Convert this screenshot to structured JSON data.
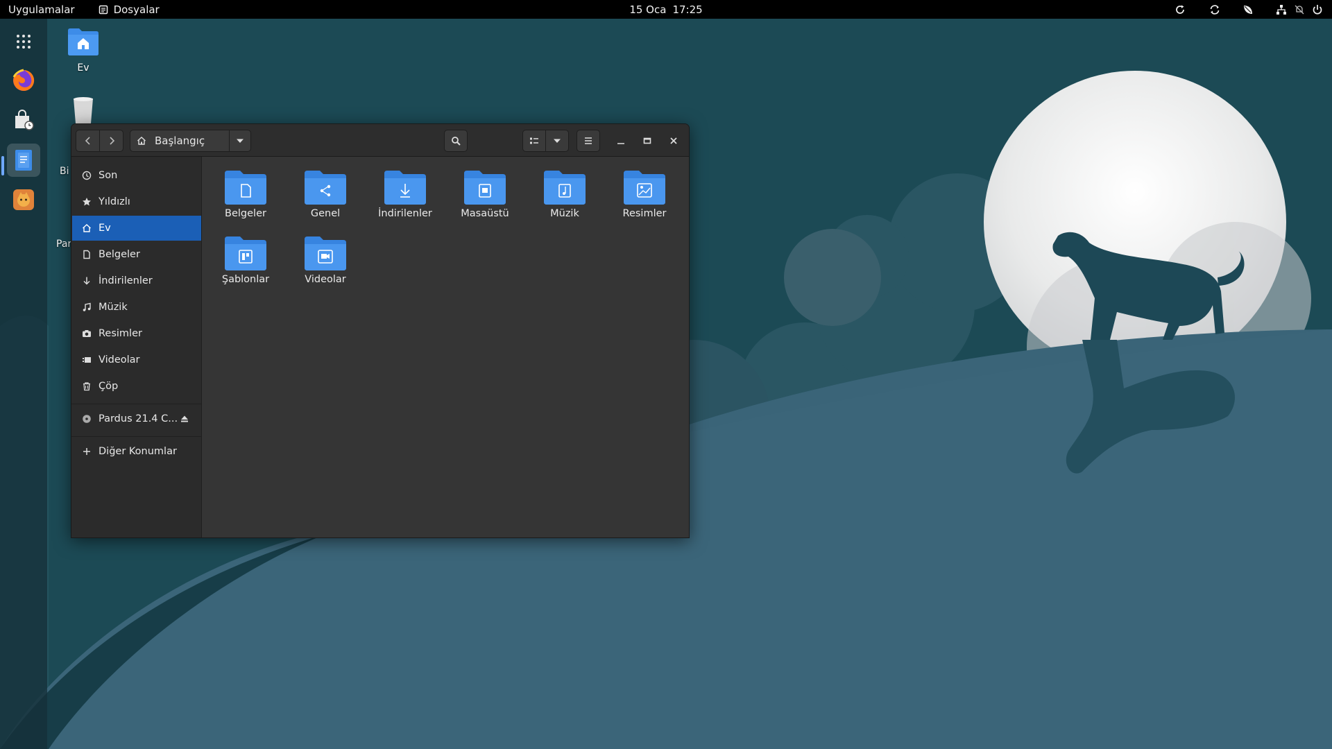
{
  "topbar": {
    "apps_label": "Uygulamalar",
    "files_label": "Dosyalar",
    "date": "15 Oca",
    "time": "17:25",
    "tray": [
      "refresh-icon",
      "sync-icon",
      "leaf-icon",
      "network-icon",
      "notifications-off-icon",
      "power-icon"
    ]
  },
  "dock": {
    "items": [
      "app-grid-icon",
      "firefox-icon",
      "software-center-icon",
      "files-icon",
      "welcome-icon"
    ]
  },
  "desktop": {
    "icons": [
      {
        "label": "Ev"
      },
      {
        "label": "Bi"
      },
      {
        "label": "Par"
      }
    ]
  },
  "window": {
    "path_label": "Başlangıç",
    "sidebar": [
      {
        "label": "Son",
        "icon": "clock-icon"
      },
      {
        "label": "Yıldızlı",
        "icon": "star-icon"
      },
      {
        "label": "Ev",
        "icon": "home-icon",
        "selected": true
      },
      {
        "label": "Belgeler",
        "icon": "document-icon"
      },
      {
        "label": "İndirilenler",
        "icon": "download-icon"
      },
      {
        "label": "Müzik",
        "icon": "music-icon"
      },
      {
        "label": "Resimler",
        "icon": "camera-icon"
      },
      {
        "label": "Videolar",
        "icon": "video-icon"
      },
      {
        "label": "Çöp",
        "icon": "trash-icon"
      }
    ],
    "device_label": "Pardus 21.4 C...",
    "other_locations_label": "Diğer Konumlar",
    "folders": [
      {
        "label": "Belgeler",
        "emblem": "document-icon"
      },
      {
        "label": "Genel",
        "emblem": "share-icon"
      },
      {
        "label": "İndirilenler",
        "emblem": "download-icon"
      },
      {
        "label": "Masaüstü",
        "emblem": "desktop-icon"
      },
      {
        "label": "Müzik",
        "emblem": "music-icon"
      },
      {
        "label": "Resimler",
        "emblem": "image-icon"
      },
      {
        "label": "Şablonlar",
        "emblem": "template-icon"
      },
      {
        "label": "Videolar",
        "emblem": "video-icon"
      }
    ]
  },
  "colors": {
    "accent": "#1b5fb6",
    "folder": "#3d8ce8",
    "wallpaper_sky": "#1c4a55",
    "wallpaper_hill": "#3a6478"
  }
}
